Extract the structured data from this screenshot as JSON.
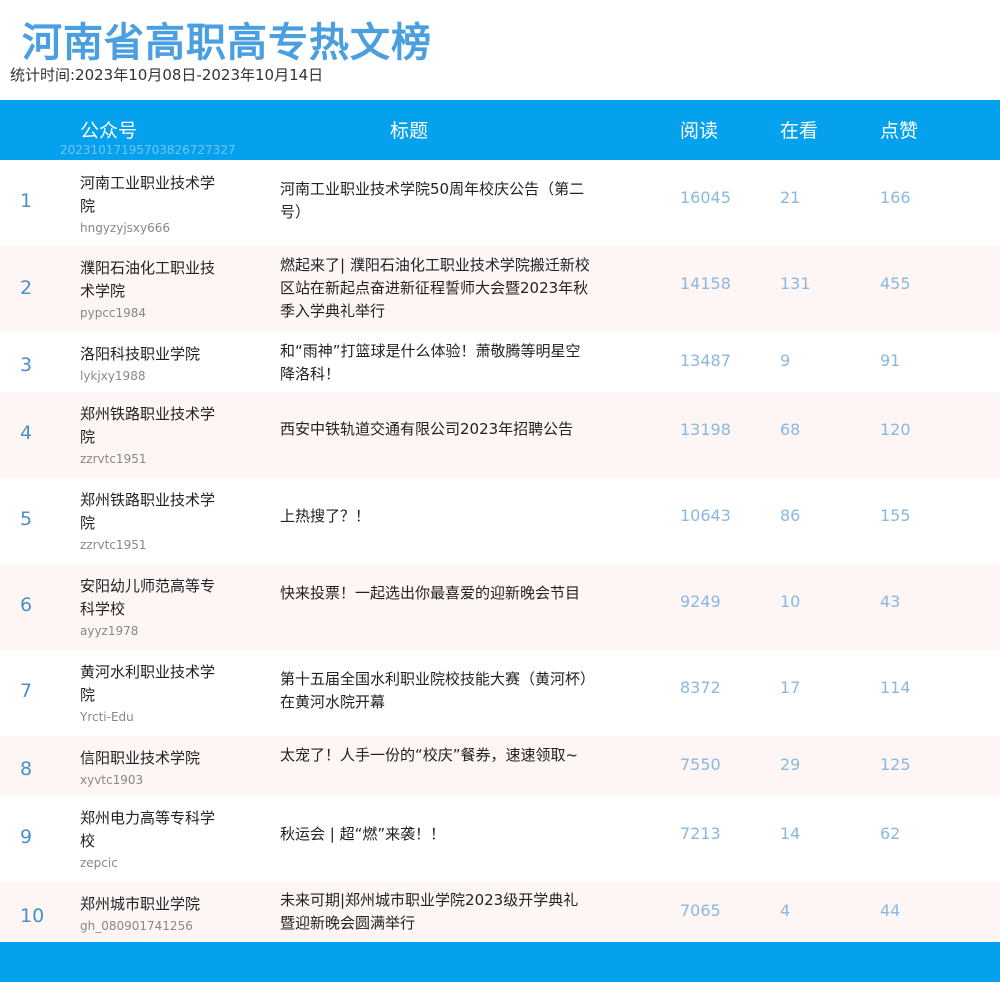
{
  "page": {
    "title": "河南省高职高专热文榜",
    "period": "统计时间:2023年10月08日-2023年10月14日"
  },
  "header": {
    "account": "公众号",
    "title": "标题",
    "read": "阅读",
    "watch": "在看",
    "like": "点赞",
    "code": "20231017195703826727327"
  },
  "rows": [
    {
      "rank": "1",
      "name": "河南工业职业技术学院",
      "id": "hngyzyjsxy666",
      "title": "河南工业职业技术学院50周年校庆公告（第二号）",
      "read": "16045",
      "watch": "21",
      "like": "166"
    },
    {
      "rank": "2",
      "name": "濮阳石油化工职业技术学院",
      "id": "pypcc1984",
      "title": "燃起来了| 濮阳石油化工职业技术学院搬迁新校区站在新起点奋进新征程誓师大会暨2023年秋季入学典礼举行",
      "read": "14158",
      "watch": "131",
      "like": "455"
    },
    {
      "rank": "3",
      "name": "洛阳科技职业学院",
      "id": "lykjxy1988",
      "title": "和“雨神”打篮球是什么体验！萧敬腾等明星空降洛科！",
      "read": "13487",
      "watch": "9",
      "like": "91"
    },
    {
      "rank": "4",
      "name": "郑州铁路职业技术学院",
      "id": "zzrvtc1951",
      "title": "西安中铁轨道交通有限公司2023年招聘公告",
      "read": "13198",
      "watch": "68",
      "like": "120"
    },
    {
      "rank": "5",
      "name": "郑州铁路职业技术学院",
      "id": "zzrvtc1951",
      "title": "上热搜了？！",
      "read": "10643",
      "watch": "86",
      "like": "155"
    },
    {
      "rank": "6",
      "name": "安阳幼儿师范高等专科学校",
      "id": "ayyz1978",
      "title": "快来投票！一起选出你最喜爱的迎新晚会节目",
      "read": "9249",
      "watch": "10",
      "like": "43"
    },
    {
      "rank": "7",
      "name": "黄河水利职业技术学院",
      "id": "Yrcti-Edu",
      "title": "第十五届全国水利职业院校技能大赛（黄河杯）在黄河水院开幕",
      "read": "8372",
      "watch": "17",
      "like": "114"
    },
    {
      "rank": "8",
      "name": "信阳职业技术学院",
      "id": "xyvtc1903",
      "title": "太宠了！人手一份的“校庆”餐券，速速领取~",
      "read": "7550",
      "watch": "29",
      "like": "125"
    },
    {
      "rank": "9",
      "name": "郑州电力高等专科学校",
      "id": "zepcic",
      "title": "秋运会 | 超“燃”来袭！！",
      "read": "7213",
      "watch": "14",
      "like": "62"
    },
    {
      "rank": "10",
      "name": "郑州城市职业学院",
      "id": "gh_080901741256",
      "title": "未来可期|郑州城市职业学院2023级开学典礼暨迎新晚会圆满举行",
      "read": "7065",
      "watch": "4",
      "like": "44"
    }
  ]
}
